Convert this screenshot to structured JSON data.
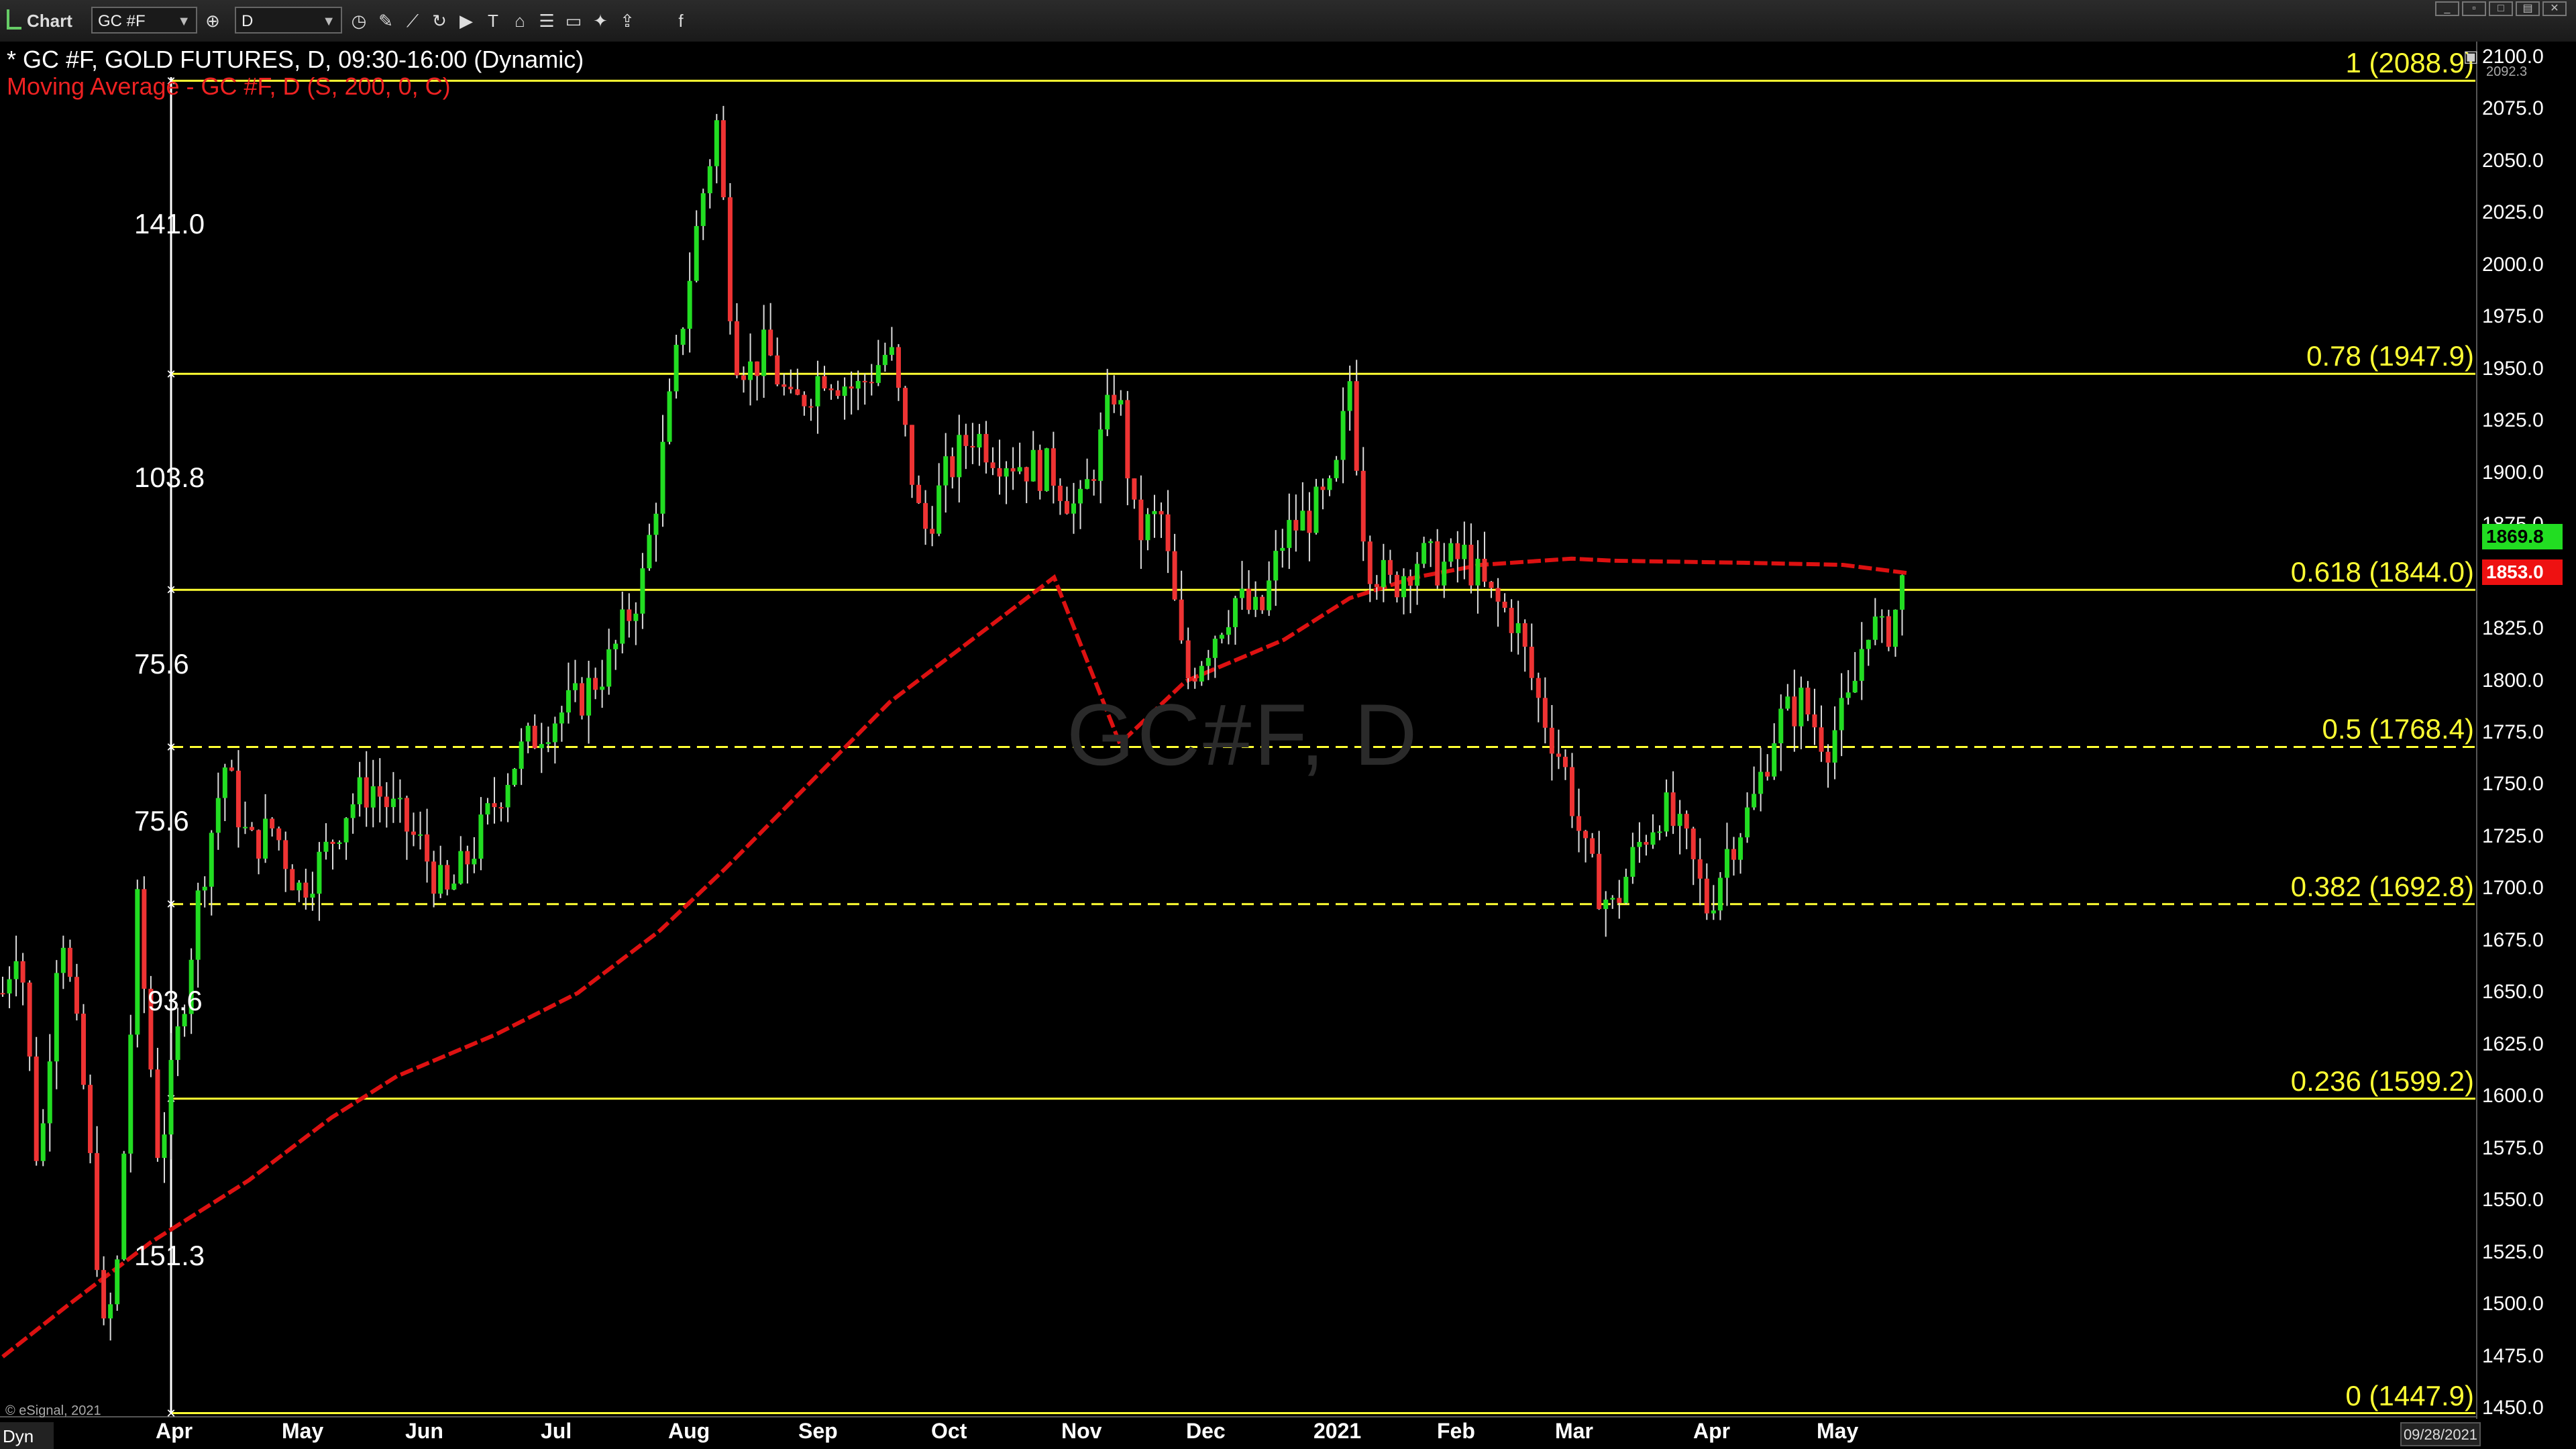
{
  "toolbar": {
    "title": "Chart",
    "symbol": "GC #F",
    "interval": "D",
    "tools": [
      "clock-icon",
      "refresh-icon",
      "draw-pencil-icon",
      "line-tool-icon",
      "cycle-icon",
      "play-icon",
      "text-tool-icon",
      "tag-icon",
      "comment-icon",
      "twitter-icon",
      "facebook-icon"
    ]
  },
  "chart": {
    "header": "* GC #F, GOLD FUTURES, D, 09:30-16:00 (Dynamic)",
    "indicator": "Moving Average - GC #F, D (S, 200, 0, C)",
    "watermark": "GC#F, D",
    "copyright": "© eSignal, 2021",
    "corner_label": "Dyn",
    "date_box": "09/28/2021",
    "y_axis_ticks": [
      "2100.0",
      "2075.0",
      "2050.0",
      "2025.0",
      "2000.0",
      "1975.0",
      "1950.0",
      "1925.0",
      "1900.0",
      "1875.0",
      "1850.0",
      "1825.0",
      "1800.0",
      "1775.0",
      "1750.0",
      "1725.0",
      "1700.0",
      "1675.0",
      "1650.0",
      "1625.0",
      "1600.0",
      "1575.0",
      "1550.0",
      "1525.0",
      "1500.0",
      "1475.0",
      "1450.0"
    ],
    "top_axis_note": "2092.3",
    "x_axis_ticks": [
      "Apr",
      "May",
      "Jun",
      "Jul",
      "Aug",
      "Sep",
      "Oct",
      "Nov",
      "Dec",
      "2021",
      "Feb",
      "Mar",
      "Apr",
      "May"
    ],
    "last_price": "1869.8",
    "ma_price": "1853.0",
    "colors": {
      "up": "#22dd22",
      "down": "#ee3333",
      "fib": "#ffff33",
      "ma": "#dd1111",
      "background": "#000000"
    }
  },
  "fib_levels": [
    {
      "label": "1 (2088.9)",
      "price": 2088.9,
      "style": "solid"
    },
    {
      "label": "0.78 (1947.9)",
      "price": 1947.9,
      "style": "solid"
    },
    {
      "label": "0.618 (1844.0)",
      "price": 1844.0,
      "style": "solid"
    },
    {
      "label": "0.5 (1768.4)",
      "price": 1768.4,
      "style": "dashed"
    },
    {
      "label": "0.382 (1692.8)",
      "price": 1692.8,
      "style": "dashed"
    },
    {
      "label": "0.236 (1599.2)",
      "price": 1599.2,
      "style": "solid"
    },
    {
      "label": "0 (1447.9)",
      "price": 1447.9,
      "style": "solid"
    }
  ],
  "measure_labels": [
    "141.0",
    "103.8",
    "75.6",
    "75.6",
    "93.6",
    "151.3"
  ],
  "chart_data": {
    "type": "candlestick",
    "title": "* GC #F, GOLD FUTURES, D, 09:30-16:00 (Dynamic)",
    "ylim": [
      1450,
      2100
    ],
    "x_labels": [
      "Apr",
      "May",
      "Jun",
      "Jul",
      "Aug",
      "Sep",
      "Oct",
      "Nov",
      "Dec",
      "2021",
      "Feb",
      "Mar",
      "Apr",
      "May"
    ],
    "price_path": [
      [
        0,
        1650
      ],
      [
        10,
        1680
      ],
      [
        22,
        1560
      ],
      [
        35,
        1690
      ],
      [
        50,
        1600
      ],
      [
        62,
        1480
      ],
      [
        70,
        1520
      ],
      [
        82,
        1690
      ],
      [
        95,
        1570
      ],
      [
        105,
        1620
      ],
      [
        120,
        1700
      ],
      [
        135,
        1760
      ],
      [
        150,
        1720
      ],
      [
        165,
        1730
      ],
      [
        180,
        1700
      ],
      [
        195,
        1715
      ],
      [
        210,
        1740
      ],
      [
        225,
        1750
      ],
      [
        240,
        1735
      ],
      [
        255,
        1720
      ],
      [
        270,
        1695
      ],
      [
        290,
        1725
      ],
      [
        310,
        1760
      ],
      [
        330,
        1780
      ],
      [
        350,
        1790
      ],
      [
        370,
        1810
      ],
      [
        390,
        1850
      ],
      [
        400,
        1900
      ],
      [
        415,
        1980
      ],
      [
        425,
        2030
      ],
      [
        435,
        2070
      ],
      [
        445,
        1960
      ],
      [
        455,
        1950
      ],
      [
        465,
        1960
      ],
      [
        480,
        1930
      ],
      [
        500,
        1950
      ],
      [
        520,
        1940
      ],
      [
        540,
        1960
      ],
      [
        560,
        1870
      ],
      [
        575,
        1900
      ],
      [
        590,
        1920
      ],
      [
        605,
        1910
      ],
      [
        620,
        1905
      ],
      [
        640,
        1900
      ],
      [
        655,
        1880
      ],
      [
        670,
        1920
      ],
      [
        678,
        1945
      ],
      [
        690,
        1870
      ],
      [
        705,
        1880
      ],
      [
        720,
        1800
      ],
      [
        735,
        1820
      ],
      [
        750,
        1840
      ],
      [
        765,
        1830
      ],
      [
        780,
        1870
      ],
      [
        795,
        1880
      ],
      [
        810,
        1890
      ],
      [
        820,
        1945
      ],
      [
        830,
        1860
      ],
      [
        845,
        1845
      ],
      [
        860,
        1860
      ],
      [
        875,
        1855
      ],
      [
        890,
        1860
      ],
      [
        905,
        1840
      ],
      [
        920,
        1830
      ],
      [
        935,
        1790
      ],
      [
        950,
        1760
      ],
      [
        965,
        1710
      ],
      [
        980,
        1690
      ],
      [
        995,
        1720
      ],
      [
        1010,
        1740
      ],
      [
        1025,
        1720
      ],
      [
        1038,
        1690
      ],
      [
        1050,
        1720
      ],
      [
        1065,
        1740
      ],
      [
        1080,
        1780
      ],
      [
        1095,
        1790
      ],
      [
        1110,
        1770
      ],
      [
        1125,
        1790
      ],
      [
        1135,
        1830
      ],
      [
        1145,
        1820
      ],
      [
        1155,
        1840
      ],
      [
        1160,
        1868
      ]
    ],
    "ma_path": [
      [
        0,
        1475
      ],
      [
        40,
        1500
      ],
      [
        90,
        1530
      ],
      [
        150,
        1560
      ],
      [
        200,
        1590
      ],
      [
        240,
        1610
      ],
      [
        300,
        1630
      ],
      [
        350,
        1650
      ],
      [
        400,
        1680
      ],
      [
        440,
        1710
      ],
      [
        490,
        1750
      ],
      [
        540,
        1790
      ],
      [
        590,
        1820
      ],
      [
        640,
        1850
      ],
      [
        680,
        1770
      ],
      [
        720,
        1800
      ],
      [
        780,
        1820
      ],
      [
        820,
        1840
      ],
      [
        860,
        1850
      ],
      [
        900,
        1856
      ],
      [
        955,
        1859
      ],
      [
        980,
        1858
      ],
      [
        1060,
        1857
      ],
      [
        1120,
        1856
      ],
      [
        1160,
        1852
      ]
    ]
  }
}
